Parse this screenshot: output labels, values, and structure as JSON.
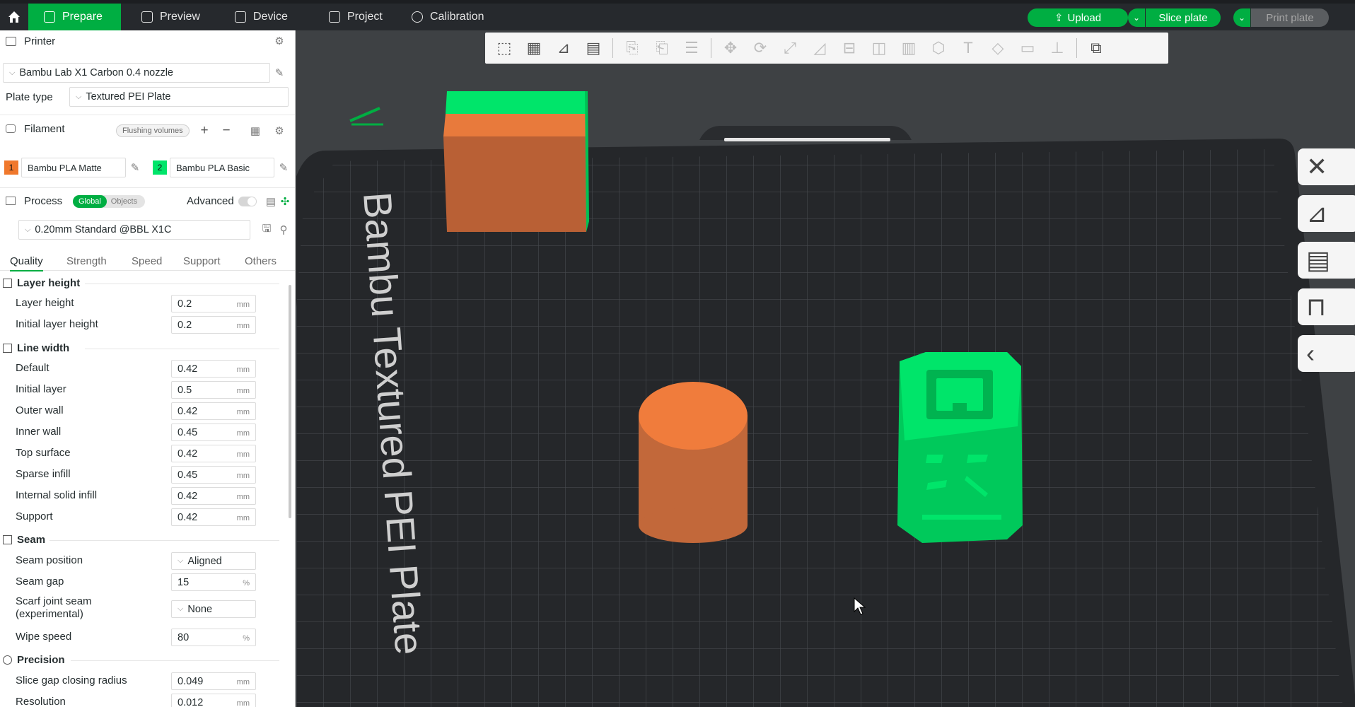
{
  "topbar": {
    "tabs": [
      {
        "label": "Prepare",
        "icon": "cube-icon"
      },
      {
        "label": "Preview",
        "icon": "layers-icon"
      },
      {
        "label": "Device",
        "icon": "device-icon"
      },
      {
        "label": "Project",
        "icon": "project-icon"
      },
      {
        "label": "Calibration",
        "icon": "calibration-icon"
      }
    ],
    "upload_label": "Upload",
    "slice_label": "Slice plate",
    "print_label": "Print plate",
    "accent": "#00ae42"
  },
  "sidebar": {
    "printer_title": "Printer",
    "printer_name": "Bambu Lab X1 Carbon 0.4 nozzle",
    "plate_type_label": "Plate type",
    "plate_type_value": "Textured PEI Plate",
    "filament_title": "Filament",
    "flushing_label": "Flushing volumes",
    "filaments": [
      {
        "index": "1",
        "name": "Bambu PLA Matte",
        "color": "#f0782c"
      },
      {
        "index": "2",
        "name": "Bambu PLA Basic",
        "color": "#00e56a"
      }
    ],
    "process_title": "Process",
    "process_toggle_global": "Global",
    "process_toggle_objects": "Objects",
    "advanced_label": "Advanced",
    "process_preset": "0.20mm Standard @BBL X1C",
    "quality_tabs": [
      "Quality",
      "Strength",
      "Speed",
      "Support",
      "Others"
    ],
    "groups": {
      "layer_height": {
        "title": "Layer height",
        "rows": [
          {
            "label": "Layer height",
            "value": "0.2",
            "unit": "mm"
          },
          {
            "label": "Initial layer height",
            "value": "0.2",
            "unit": "mm"
          }
        ]
      },
      "line_width": {
        "title": "Line width",
        "rows": [
          {
            "label": "Default",
            "value": "0.42",
            "unit": "mm"
          },
          {
            "label": "Initial layer",
            "value": "0.5",
            "unit": "mm"
          },
          {
            "label": "Outer wall",
            "value": "0.42",
            "unit": "mm"
          },
          {
            "label": "Inner wall",
            "value": "0.45",
            "unit": "mm"
          },
          {
            "label": "Top surface",
            "value": "0.42",
            "unit": "mm"
          },
          {
            "label": "Sparse infill",
            "value": "0.45",
            "unit": "mm"
          },
          {
            "label": "Internal solid infill",
            "value": "0.42",
            "unit": "mm"
          },
          {
            "label": "Support",
            "value": "0.42",
            "unit": "mm"
          }
        ]
      },
      "seam": {
        "title": "Seam",
        "seam_position_label": "Seam position",
        "seam_position_value": "Aligned",
        "seam_gap_label": "Seam gap",
        "seam_gap_value": "15",
        "seam_gap_unit": "%",
        "scarf_label_1": "Scarf joint seam",
        "scarf_label_2": "(experimental)",
        "scarf_value": "None",
        "wipe_label": "Wipe speed",
        "wipe_value": "80",
        "wipe_unit": "%"
      },
      "precision": {
        "title": "Precision",
        "rows": [
          {
            "label": "Slice gap closing radius",
            "value": "0.049",
            "unit": "mm"
          },
          {
            "label": "Resolution",
            "value": "0.012",
            "unit": "mm"
          }
        ]
      }
    }
  },
  "viewport": {
    "plate_text": "Bambu Textured PEI Plate",
    "plate_color": "#25272a",
    "object_colors": {
      "orange": "#e87a3c",
      "green": "#00e56a"
    }
  }
}
